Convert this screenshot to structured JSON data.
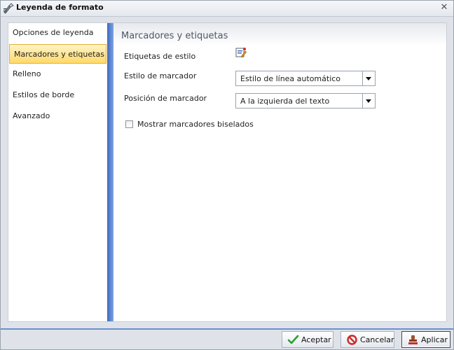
{
  "window": {
    "title": "Leyenda de formato",
    "title_icon": "format-legend-icon",
    "close_icon": "close-icon",
    "close_glyph": "✕"
  },
  "sidebar": {
    "items": [
      {
        "label": "Opciones de leyenda",
        "selected": false
      },
      {
        "label": "Marcadores y etiquetas",
        "selected": true
      },
      {
        "label": "Relleno",
        "selected": false
      },
      {
        "label": "Estilos de borde",
        "selected": false
      },
      {
        "label": "Avanzado",
        "selected": false
      }
    ]
  },
  "panel": {
    "title": "Marcadores y etiquetas",
    "label_style": {
      "label": "Etiquetas de estilo",
      "icon": "style-labels-icon"
    },
    "marker_style": {
      "label": "Estilo de marcador",
      "value": "Estilo de línea automático"
    },
    "marker_position": {
      "label": "Posición de marcador",
      "value": "A la izquierda del texto"
    },
    "beveled_markers": {
      "label": "Mostrar marcadores biselados",
      "checked": false
    }
  },
  "footer": {
    "ok_label": "Aceptar",
    "cancel_label": "Cancelar",
    "apply_label": "Aplicar"
  },
  "colors": {
    "accent_blue": "#3d6bc2",
    "selected_item": "#ffd96a",
    "ok_icon": "#2e9e2e",
    "cancel_icon": "#cc2a2a"
  }
}
